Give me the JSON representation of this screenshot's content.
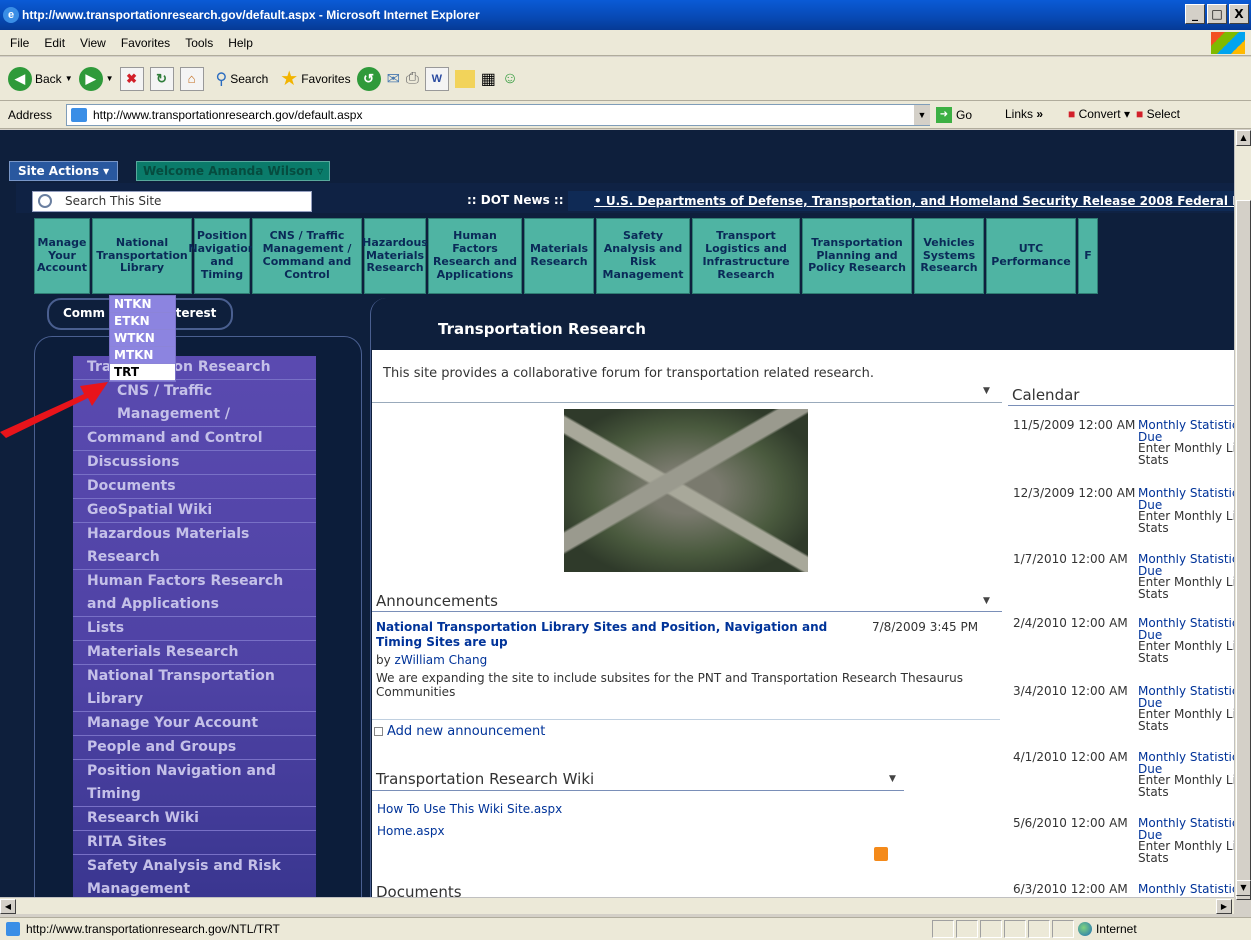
{
  "window": {
    "title": "http://www.transportationresearch.gov/default.aspx - Microsoft Internet Explorer",
    "controls": [
      "_",
      "□",
      "X"
    ]
  },
  "menu": [
    "File",
    "Edit",
    "View",
    "Favorites",
    "Tools",
    "Help"
  ],
  "toolbar": {
    "back": "Back",
    "search": "Search",
    "favorites": "Favorites"
  },
  "address": {
    "label": "Address",
    "url": "http://www.transportationresearch.gov/default.aspx",
    "go": "Go",
    "links": "Links",
    "links_chevron": "»",
    "convert": "Convert",
    "select": "Select"
  },
  "site": {
    "site_actions": "Site Actions ▾",
    "welcome": "Welcome Amanda Wilson ▿",
    "search_placeholder": "Search This Site",
    "dot_news": ":: DOT News ::",
    "ticker": "• U.S. Departments of Defense, Transportation, and Homeland Security Release 2008 Federal Ra"
  },
  "nav_tabs": [
    "Manage Your Account",
    "National Transportation Library",
    "Position Navigation and Timing",
    "CNS / Traffic Management / Command and Control",
    "Hazardous Materials Research",
    "Human Factors Research and Applications",
    "Materials Research",
    "Safety Analysis and Risk Management",
    "Transport Logistics and Infrastructure Research",
    "Transportation Planning and Policy Research",
    "Vehicles Systems Research",
    "UTC Performance",
    "F"
  ],
  "communities": "Communities of Interest",
  "community_label_left": "Comm",
  "community_label_right": "nterest",
  "flyout": [
    "NTKN",
    "ETKN",
    "WTKN",
    "MTKN",
    "TRT"
  ],
  "left_nav": [
    "Transportation Research",
    "CNS / Traffic Management /",
    "Command and Control",
    "Discussions",
    "Documents",
    "GeoSpatial Wiki",
    "Hazardous Materials",
    "Research",
    "Human Factors Research",
    "and Applications",
    "Lists",
    "Materials Research",
    "National Transportation",
    "Library",
    "Manage Your Account",
    "People and Groups",
    "Position Navigation and",
    "Timing",
    "Research Wiki",
    "RITA Sites",
    "Safety Analysis and Risk",
    "Management"
  ],
  "left_nav_partial": {
    "first": "Tra",
    "first_rest": "on Research",
    "second": "CNS / Traffic Management /"
  },
  "main": {
    "title": "Transportation Research",
    "intro": "This site provides a collaborative forum for transportation related research.",
    "announcements_title": "Announcements",
    "announcement": {
      "title": "National Transportation Library Sites and Position, Navigation and Timing Sites are up",
      "date": "7/8/2009 3:45 PM",
      "by_prefix": "by",
      "author": "zWilliam Chang",
      "body": "We are expanding the site to include subsites for the PNT and Transportation Research Thesaurus Communities"
    },
    "add_new": "Add new announcement",
    "wiki_title": "Transportation Research Wiki",
    "wiki_links": [
      "How To Use This Wiki Site.aspx",
      "Home.aspx"
    ],
    "documents_title": "Documents"
  },
  "calendar": {
    "title": "Calendar",
    "entries": [
      {
        "date": "11/5/2009 12:00 AM",
        "title": "Monthly Statistic",
        "title2": "Due",
        "desc": "Enter Monthly Li",
        "desc2": "Stats"
      },
      {
        "date": "12/3/2009 12:00 AM",
        "title": "Monthly Statistic",
        "title2": "Due",
        "desc": "Enter Monthly Li",
        "desc2": "Stats"
      },
      {
        "date": "1/7/2010 12:00 AM",
        "title": "Monthly Statistic",
        "title2": "Due",
        "desc": "Enter Monthly Li",
        "desc2": "Stats"
      },
      {
        "date": "2/4/2010 12:00 AM",
        "title": "Monthly Statistic",
        "title2": "Due",
        "desc": "Enter Monthly Li",
        "desc2": "Stats"
      },
      {
        "date": "3/4/2010 12:00 AM",
        "title": "Monthly Statistic",
        "title2": "Due",
        "desc": "Enter Monthly Li",
        "desc2": "Stats"
      },
      {
        "date": "4/1/2010 12:00 AM",
        "title": "Monthly Statistic",
        "title2": "Due",
        "desc": "Enter Monthly Li",
        "desc2": "Stats"
      },
      {
        "date": "5/6/2010 12:00 AM",
        "title": "Monthly Statistic",
        "title2": "Due",
        "desc": "Enter Monthly Li",
        "desc2": "Stats"
      },
      {
        "date": "6/3/2010 12:00 AM",
        "title": "Monthly Statistic",
        "title2": "",
        "desc": "",
        "desc2": ""
      }
    ]
  },
  "status": {
    "url": "http://www.transportationresearch.gov/NTL/TRT",
    "zone": "Internet"
  },
  "colors": {
    "nav_tab": "#4fb4a3",
    "left_nav": "#5a4ab0",
    "page_bg": "#0e1f3c",
    "pointer_arrow": "#e8141b"
  }
}
